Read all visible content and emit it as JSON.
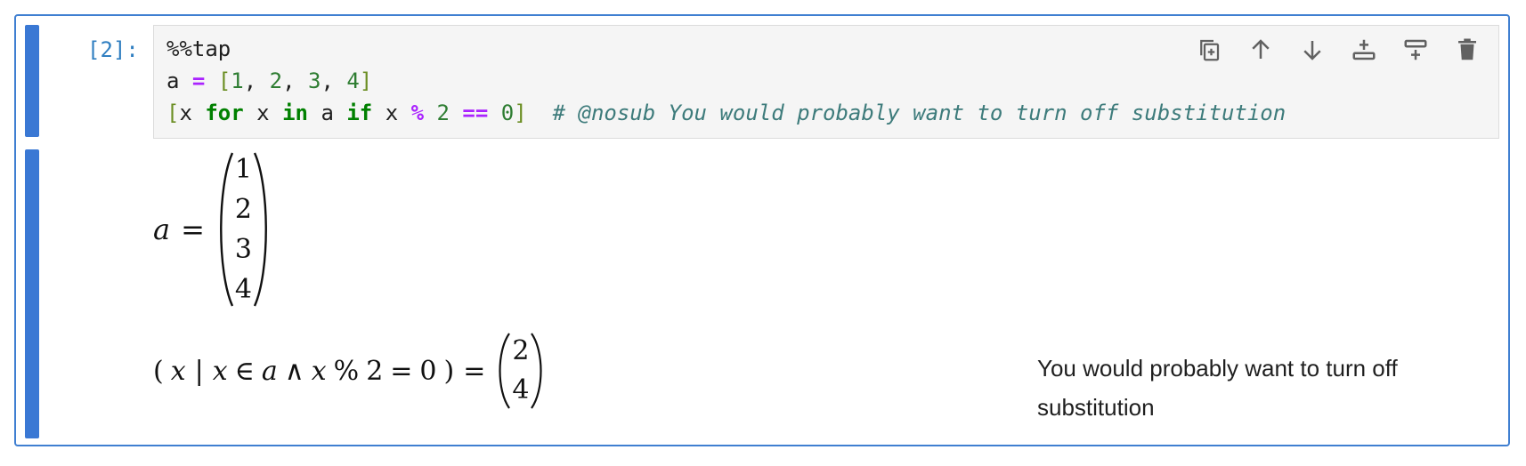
{
  "cell": {
    "prompt": "[2]:",
    "code": {
      "line1": "%%tap",
      "line2": {
        "var": "a",
        "eq": "=",
        "lbr": "[",
        "n1": "1",
        "n2": "2",
        "n3": "3",
        "n4": "4",
        "rbr": "]",
        "sep": ", "
      },
      "line3": {
        "lbr": "[",
        "x1": "x",
        "for": "for",
        "x2": "x",
        "in": "in",
        "a": "a",
        "if": "if",
        "x3": "x",
        "mod": "%",
        "two": "2",
        "eqeq": "==",
        "zero": "0",
        "rbr": "]",
        "comment": "# @nosub You would probably want to turn off substitution"
      }
    },
    "toolbar": [
      {
        "name": "duplicate-cell-icon"
      },
      {
        "name": "move-up-icon"
      },
      {
        "name": "move-down-icon"
      },
      {
        "name": "insert-above-icon"
      },
      {
        "name": "insert-below-icon"
      },
      {
        "name": "delete-cell-icon"
      }
    ]
  },
  "output": {
    "eq1": {
      "lhs": "a",
      "rel": "=",
      "values": [
        "1",
        "2",
        "3",
        "4"
      ]
    },
    "eq2": {
      "lp": "(",
      "x": "x",
      "bar": "|",
      "x2": "x",
      "in": "∈",
      "a": "a",
      "and": "∧",
      "x3": "x",
      "mod": "%",
      "two": "2",
      "eq": "=",
      "zero": "0",
      "rp": ")",
      "rel": "=",
      "values": [
        "2",
        "4"
      ]
    },
    "comment": "You would probably want to turn off substitution"
  },
  "colors": {
    "accent": "#3a78d4",
    "border": "#3f7fd1",
    "prompt": "#307fc1"
  }
}
